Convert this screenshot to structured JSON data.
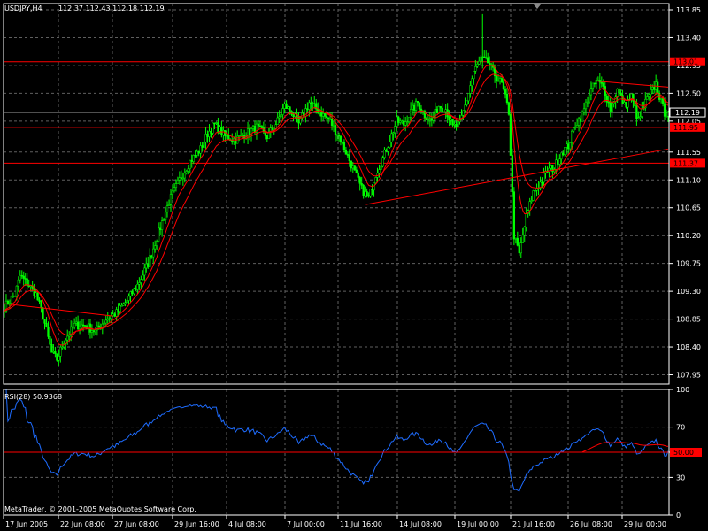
{
  "colors": {
    "background": "#000000",
    "grid": "#5f5f5f",
    "frame": "#ffffff",
    "bull": "#00ff00",
    "bear": "#00ff00",
    "ma": "#ff0000",
    "level": "#ff0000",
    "current_price_line": "#a0a0a0",
    "rsi_line": "#1e6cff",
    "text": "#ffffff"
  },
  "header": {
    "symbol": "USDJPY,H4",
    "quote": "112.37 112.43 112.18 112.19"
  },
  "footer": {
    "copyright": "MetaTrader, © 2001-2005 MetaQuotes Software Corp."
  },
  "chart_data": {
    "type": "candlestick",
    "symbol": "USDJPY",
    "timeframe": "H4",
    "ylim": [
      107.8,
      113.95
    ],
    "y_ticks": [
      "113.85",
      "113.40",
      "112.95",
      "112.50",
      "112.05",
      "111.55",
      "111.10",
      "110.65",
      "110.20",
      "109.75",
      "109.30",
      "108.85",
      "108.40",
      "107.95"
    ],
    "x_ticks": [
      "17 Jun 2005",
      "22 Jun 08:00",
      "27 Jun 08:00",
      "29 Jun 16:00",
      "4 Jul 08:00",
      "7 Jul 00:00",
      "11 Jul 16:00",
      "14 Jul 08:00",
      "19 Jul 00:00",
      "21 Jul 16:00",
      "26 Jul 08:00",
      "29 Jul 00:00"
    ],
    "current_price": "112.19",
    "current_price_value": 112.19,
    "levels": [
      {
        "label": "113.01",
        "value": 113.01
      },
      {
        "label": "111.95",
        "value": 111.95
      },
      {
        "label": "111.37",
        "value": 111.37
      }
    ],
    "trendlines": [
      {
        "from_bar": 0,
        "from": 109.1,
        "to_bar": 62,
        "to": 108.9
      },
      {
        "from_bar": 206,
        "from": 110.7,
        "to_bar": 379,
        "to": 111.6
      },
      {
        "from_bar": 337,
        "from": 112.7,
        "to_bar": 379,
        "to": 112.6
      }
    ],
    "path_points": [
      [
        0,
        109.05
      ],
      [
        6,
        109.25
      ],
      [
        9,
        109.55
      ],
      [
        14,
        109.4
      ],
      [
        18,
        109.25
      ],
      [
        22,
        108.9
      ],
      [
        27,
        108.3
      ],
      [
        30,
        108.2
      ],
      [
        34,
        108.5
      ],
      [
        40,
        108.75
      ],
      [
        46,
        108.75
      ],
      [
        52,
        108.65
      ],
      [
        58,
        108.85
      ],
      [
        64,
        108.95
      ],
      [
        70,
        109.15
      ],
      [
        76,
        109.4
      ],
      [
        82,
        109.75
      ],
      [
        88,
        110.25
      ],
      [
        94,
        110.75
      ],
      [
        100,
        111.1
      ],
      [
        106,
        111.4
      ],
      [
        112,
        111.6
      ],
      [
        116,
        111.85
      ],
      [
        120,
        112.0
      ],
      [
        126,
        111.8
      ],
      [
        132,
        111.75
      ],
      [
        138,
        111.85
      ],
      [
        144,
        111.95
      ],
      [
        150,
        111.8
      ],
      [
        156,
        112.05
      ],
      [
        160,
        112.3
      ],
      [
        164,
        112.2
      ],
      [
        168,
        112.0
      ],
      [
        174,
        112.35
      ],
      [
        180,
        112.2
      ],
      [
        186,
        112.05
      ],
      [
        192,
        111.75
      ],
      [
        198,
        111.35
      ],
      [
        204,
        110.95
      ],
      [
        208,
        110.8
      ],
      [
        212,
        111.2
      ],
      [
        216,
        111.45
      ],
      [
        220,
        111.75
      ],
      [
        224,
        112.05
      ],
      [
        228,
        112.0
      ],
      [
        232,
        112.2
      ],
      [
        236,
        112.35
      ],
      [
        240,
        112.15
      ],
      [
        244,
        112.05
      ],
      [
        248,
        112.3
      ],
      [
        252,
        112.25
      ],
      [
        256,
        111.95
      ],
      [
        260,
        112.0
      ],
      [
        264,
        112.4
      ],
      [
        268,
        112.85
      ],
      [
        272,
        113.05
      ],
      [
        276,
        113.0
      ],
      [
        280,
        112.8
      ],
      [
        284,
        112.65
      ],
      [
        288,
        112.2
      ],
      [
        291,
        110.2
      ],
      [
        294,
        109.9
      ],
      [
        298,
        110.5
      ],
      [
        302,
        110.9
      ],
      [
        306,
        111.05
      ],
      [
        310,
        111.25
      ],
      [
        314,
        111.3
      ],
      [
        318,
        111.55
      ],
      [
        322,
        111.65
      ],
      [
        326,
        112.0
      ],
      [
        330,
        112.15
      ],
      [
        334,
        112.5
      ],
      [
        338,
        112.7
      ],
      [
        342,
        112.6
      ],
      [
        346,
        112.25
      ],
      [
        350,
        112.55
      ],
      [
        354,
        112.3
      ],
      [
        358,
        112.45
      ],
      [
        362,
        112.05
      ],
      [
        366,
        112.35
      ],
      [
        370,
        112.55
      ],
      [
        372,
        112.65
      ],
      [
        375,
        112.35
      ],
      [
        377,
        112.19
      ]
    ],
    "rsi": {
      "label": "RSI(28) 50.9368",
      "period": 28,
      "value": 50.9368,
      "ylim": [
        0,
        100
      ],
      "y_ticks": [
        "100",
        "70",
        "50.00",
        "30",
        "0"
      ],
      "level": {
        "label": "50.00",
        "value": 50
      }
    }
  }
}
